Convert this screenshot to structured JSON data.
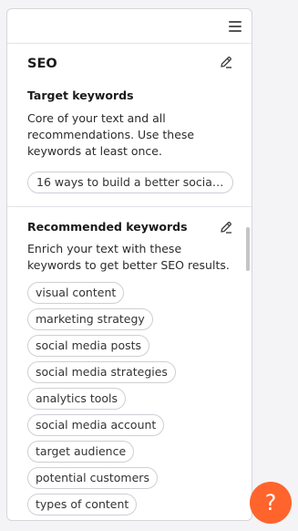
{
  "seo": {
    "title": "SEO",
    "target": {
      "heading": "Target keywords",
      "description": "Core of your text and all recommendations. Use these keywords at least once.",
      "keyword": "16 ways to build a better social …"
    },
    "recommended": {
      "heading": "Recommended keywords",
      "description": "Enrich your text with these keywords to get better SEO results.",
      "keywords": [
        "visual content",
        "marketing strategy",
        "social media posts",
        "social media strategies",
        "analytics tools",
        "social media account",
        "target audience",
        "potential customers",
        "types of content"
      ]
    }
  },
  "help": {
    "label": "?"
  },
  "icons": {
    "menu": "hamburger-menu-icon",
    "edit": "pencil-icon"
  },
  "colors": {
    "accent": "#ff642d",
    "border": "#d6d6db"
  }
}
